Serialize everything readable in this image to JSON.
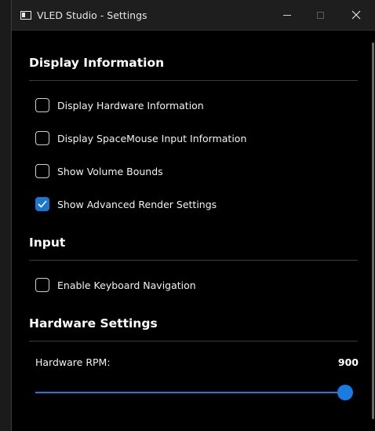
{
  "window": {
    "title": "VLED Studio - Settings",
    "icon": "app-window-icon"
  },
  "sections": {
    "display": {
      "title": "Display Information"
    },
    "input": {
      "title": "Input"
    },
    "hardware": {
      "title": "Hardware Settings"
    }
  },
  "checkboxes": [
    {
      "label": "Display Hardware Information",
      "checked": false
    },
    {
      "label": "Display SpaceMouse Input Information",
      "checked": false
    },
    {
      "label": "Show Volume Bounds",
      "checked": false
    },
    {
      "label": "Show Advanced Render Settings",
      "checked": true
    },
    {
      "label": "Enable Keyboard Navigation",
      "checked": false
    }
  ],
  "hardware": {
    "rpm_label": "Hardware RPM:",
    "rpm_value": "900",
    "rpm_fraction": 1.0
  },
  "colors": {
    "accent": "#1a7be0",
    "background": "#000000",
    "titlebar": "#1e1e1e"
  }
}
